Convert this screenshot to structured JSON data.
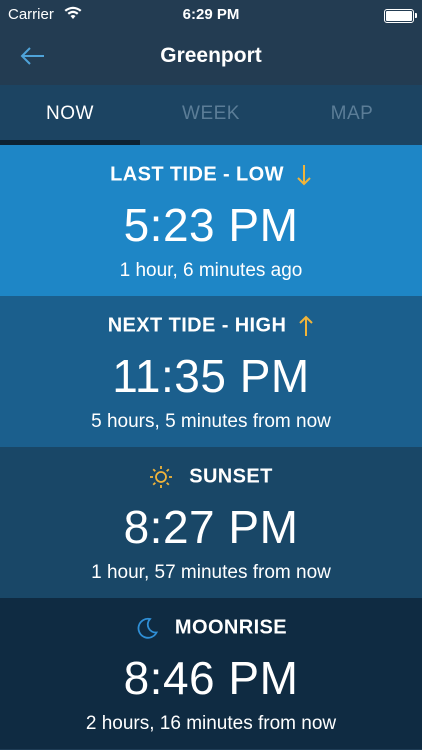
{
  "status_bar": {
    "carrier": "Carrier",
    "time": "6:29 PM"
  },
  "nav": {
    "title": "Greenport"
  },
  "tabs": [
    {
      "label": "NOW",
      "active": true
    },
    {
      "label": "WEEK",
      "active": false
    },
    {
      "label": "MAP",
      "active": false
    }
  ],
  "cards": [
    {
      "title": "LAST TIDE - LOW",
      "time": "5:23 PM",
      "relative": "1 hour, 6 minutes ago",
      "icon": "arrow-down-icon",
      "bg": "#1e86c6"
    },
    {
      "title": "NEXT TIDE - HIGH",
      "time": "11:35 PM",
      "relative": "5 hours, 5 minutes from now",
      "icon": "arrow-up-icon",
      "bg": "#1b5f8d"
    },
    {
      "title": "SUNSET",
      "time": "8:27 PM",
      "relative": "1 hour, 57 minutes from now",
      "icon": "sun-icon",
      "bg": "#194767"
    },
    {
      "title": "MOONRISE",
      "time": "8:46 PM",
      "relative": "2 hours, 16 minutes from now",
      "icon": "moon-icon",
      "bg": "#0f2b42"
    }
  ],
  "colors": {
    "accent": "#f0b43a",
    "nav_bg": "#233c52",
    "moon": "#2f8fd6"
  }
}
